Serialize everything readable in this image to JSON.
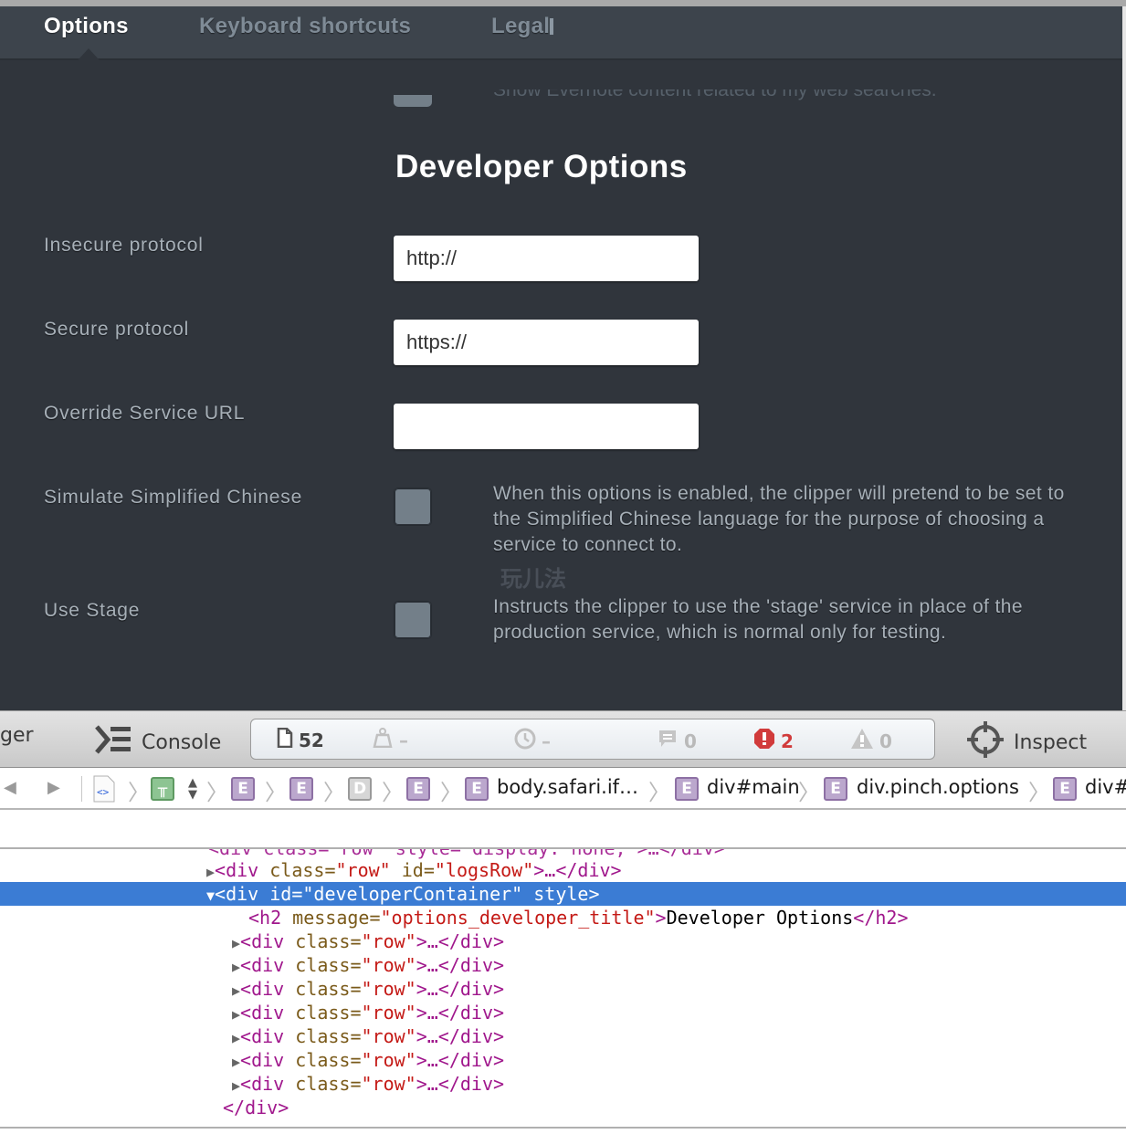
{
  "tabs": [
    {
      "label": "Options",
      "active": true
    },
    {
      "label": "Keyboard shortcuts",
      "active": false
    },
    {
      "label": "Legal",
      "active": false
    }
  ],
  "partial_row_text": "Show Evernote content related to my web searches.",
  "section_title": "Developer Options",
  "rows": [
    {
      "label": "Insecure protocol",
      "type": "text",
      "value": "http://"
    },
    {
      "label": "Secure protocol",
      "type": "text",
      "value": "https://"
    },
    {
      "label": "Override Service URL",
      "type": "text",
      "value": ""
    },
    {
      "label": "Simulate Simplified Chinese",
      "type": "checkbox",
      "checked": false,
      "description": "When this options is enabled, the clipper will pretend to be set to the Simplified Chinese language for the purpose of choosing a service to connect to."
    },
    {
      "label": "Use Stage",
      "type": "checkbox",
      "checked": false,
      "description": "Instructs the clipper to use the 'stage' service in place of the production service, which is normal only for testing."
    }
  ],
  "watermark": "玩儿法",
  "inspector": {
    "toolbar": {
      "debugger_label_partial": "ger",
      "console_label": "Console",
      "inspect_label": "Inspect",
      "dashboard": {
        "resources_count": "52",
        "resource_size": "–",
        "load_time": "–",
        "logs_count": "0",
        "errors_count": "2",
        "warnings_count": "0"
      },
      "colors": {
        "error": "#d13b3b",
        "dim": "#b0b0b0"
      }
    },
    "breadcrumbs": [
      {
        "badge": "",
        "kind": "document"
      },
      {
        "badge": "",
        "kind": "frame"
      },
      {
        "badge": "E",
        "kind": "element"
      },
      {
        "badge": "E",
        "kind": "element"
      },
      {
        "badge": "D",
        "kind": "document"
      },
      {
        "badge": "E",
        "kind": "element"
      },
      {
        "badge": "E",
        "kind": "element",
        "text": "body.safari.if…"
      },
      {
        "badge": "E",
        "kind": "element",
        "text": "div#main"
      },
      {
        "badge": "E",
        "kind": "element",
        "text": "div.pinch.options"
      },
      {
        "badge": "E",
        "kind": "element",
        "text": "div#"
      }
    ],
    "dom_tree": {
      "partial_top_line": "<div class=\"row\" style=\"display: none;\">…</div>",
      "logs_row": {
        "tag_open": "<div",
        "attr": " class=",
        "val1": "\"row\"",
        "attr2": " id=",
        "val2": "\"logsRow\"",
        "close": ">…</div>"
      },
      "selected": {
        "tag_open": "<div",
        "attr": " id=",
        "val": "\"developerContainer\"",
        "attr2": " style",
        "close": ">"
      },
      "h2": {
        "tag_open": "<h2",
        "attr": " message=",
        "val": "\"options_developer_title\"",
        "gt": ">",
        "text": "Developer Options",
        "close": "</h2>"
      },
      "row_lines": [
        {
          "tag_open": "<div",
          "attr": " class=",
          "val": "\"row\"",
          "close": ">…</div>"
        },
        {
          "tag_open": "<div",
          "attr": " class=",
          "val": "\"row\"",
          "close": ">…</div>"
        },
        {
          "tag_open": "<div",
          "attr": " class=",
          "val": "\"row\"",
          "close": ">…</div>"
        },
        {
          "tag_open": "<div",
          "attr": " class=",
          "val": "\"row\"",
          "close": ">…</div>"
        },
        {
          "tag_open": "<div",
          "attr": " class=",
          "val": "\"row\"",
          "close": ">…</div>"
        },
        {
          "tag_open": "<div",
          "attr": " class=",
          "val": "\"row\"",
          "close": ">…</div>"
        },
        {
          "tag_open": "<div",
          "attr": " class=",
          "val": "\"row\"",
          "close": ">…</div>"
        }
      ],
      "close_div": "</div>"
    }
  }
}
